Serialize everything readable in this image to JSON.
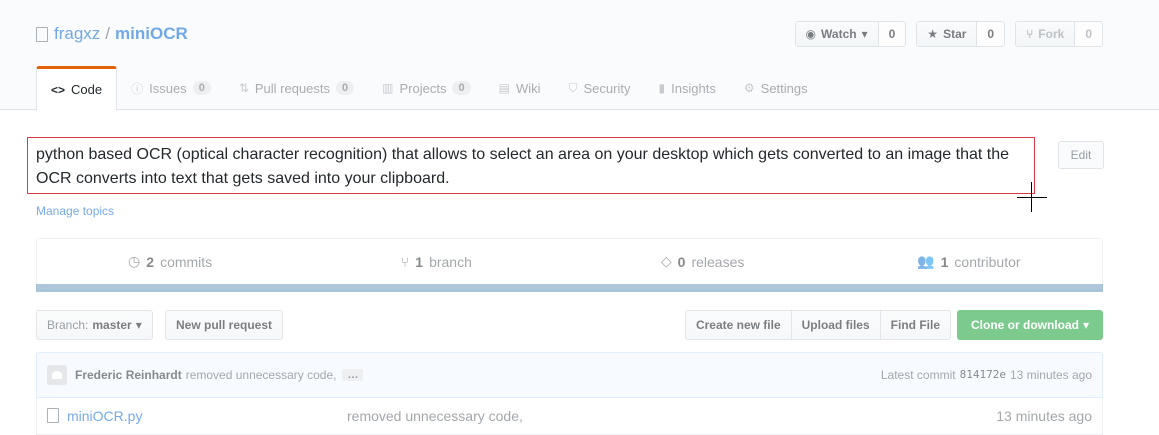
{
  "repo": {
    "owner": "fragxz",
    "separator": "/",
    "name": "miniOCR"
  },
  "actions": {
    "watch_label": "Watch",
    "watch_count": "0",
    "star_label": "Star",
    "star_count": "0",
    "fork_label": "Fork",
    "fork_count": "0"
  },
  "tabs": [
    {
      "label": "Code",
      "icon": "code-icon"
    },
    {
      "label": "Issues",
      "count": "0",
      "icon": "issue-icon"
    },
    {
      "label": "Pull requests",
      "count": "0",
      "icon": "pull-request-icon"
    },
    {
      "label": "Projects",
      "count": "0",
      "icon": "project-icon"
    },
    {
      "label": "Wiki",
      "icon": "wiki-icon"
    },
    {
      "label": "Security",
      "icon": "shield-icon"
    },
    {
      "label": "Insights",
      "icon": "graph-icon"
    },
    {
      "label": "Settings",
      "icon": "gear-icon"
    }
  ],
  "description": {
    "text": "python based OCR (optical character recognition) that allows to select an area on your desktop which gets converted to an image that the OCR converts into text that gets saved into your clipboard.",
    "edit_label": "Edit",
    "manage_topics": "Manage topics"
  },
  "summary": {
    "commits_count": "2",
    "commits_label": "commits",
    "branch_count": "1",
    "branch_label": "branch",
    "releases_count": "0",
    "releases_label": "releases",
    "contributor_count": "1",
    "contributor_label": "contributor"
  },
  "filenav": {
    "branch_prefix": "Branch:",
    "branch_name": "master",
    "new_pr": "New pull request",
    "create_file": "Create new file",
    "upload_files": "Upload files",
    "find_file": "Find File",
    "clone": "Clone or download"
  },
  "commit": {
    "author": "Frederic Reinhardt",
    "message": "removed unnecessary code,",
    "ellipsis": "…",
    "latest_label": "Latest commit",
    "sha": "814172e",
    "age": "13 minutes ago"
  },
  "files": [
    {
      "name": "miniOCR.py",
      "message": "removed unnecessary code,",
      "age": "13 minutes ago"
    }
  ],
  "colors": {
    "accent": "#0366d6",
    "selection": "#d73a49",
    "clone": "#28a745",
    "tab_active": "#e36209"
  }
}
